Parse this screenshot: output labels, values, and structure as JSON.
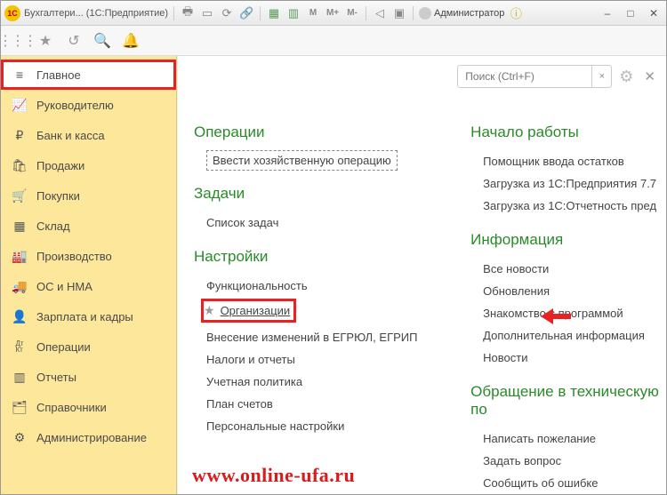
{
  "titlebar": {
    "logo_text": "1C",
    "title": "Бухгалтери...  (1С:Предприятие)",
    "m_labels": [
      "M",
      "M+",
      "M-"
    ],
    "user": "Администратор"
  },
  "search": {
    "placeholder": "Поиск (Ctrl+F)"
  },
  "sidebar": {
    "items": [
      {
        "label": "Главное"
      },
      {
        "label": "Руководителю"
      },
      {
        "label": "Банк и касса"
      },
      {
        "label": "Продажи"
      },
      {
        "label": "Покупки"
      },
      {
        "label": "Склад"
      },
      {
        "label": "Производство"
      },
      {
        "label": "ОС и НМА"
      },
      {
        "label": "Зарплата и кадры"
      },
      {
        "label": "Операции"
      },
      {
        "label": "Отчеты"
      },
      {
        "label": "Справочники"
      },
      {
        "label": "Администрирование"
      }
    ]
  },
  "main": {
    "col1": {
      "h_ops": "Операции",
      "op_link": "Ввести хозяйственную операцию",
      "h_tasks": "Задачи",
      "tasks_link": "Список задач",
      "h_settings": "Настройки",
      "s1": "Функциональность",
      "s2": "Организации",
      "s3": "Внесение изменений в ЕГРЮЛ, ЕГРИП",
      "s4": "Налоги и отчеты",
      "s5": "Учетная политика",
      "s6": "План счетов",
      "s7": "Персональные настройки"
    },
    "col2": {
      "h_start": "Начало работы",
      "st1": "Помощник ввода остатков",
      "st2": "Загрузка из 1С:Предприятия 7.7",
      "st3": "Загрузка из 1С:Отчетность пред",
      "h_info": "Информация",
      "i1": "Все новости",
      "i2": "Обновления",
      "i3": "Знакомство с программой",
      "i4": "Дополнительная информация",
      "i5": "Новости",
      "h_support": "Обращение в техническую по",
      "sp1": "Написать пожелание",
      "sp2": "Задать вопрос",
      "sp3": "Сообщить об ошибке"
    }
  },
  "watermark": "www.online-ufa.ru"
}
